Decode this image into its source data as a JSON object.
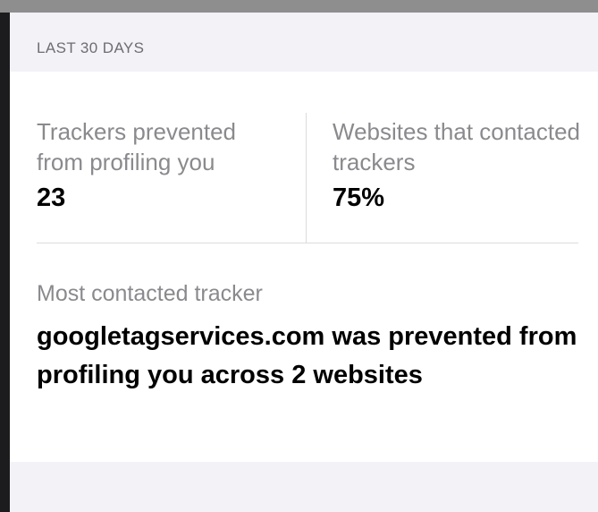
{
  "header": {
    "period_label": "LAST 30 DAYS"
  },
  "stats": {
    "trackers_prevented": {
      "label": "Trackers prevented from profiling you",
      "value": "23"
    },
    "websites_contacted": {
      "label": "Websites that contacted trackers",
      "value": "75%"
    }
  },
  "most_contacted": {
    "label": "Most contacted tracker",
    "description": "googletagservices.com was prevented from profiling you across 2 websites"
  },
  "colors": {
    "background": "#f2f2f7",
    "card": "#ffffff",
    "secondary_text": "#8a8a8e",
    "header_text": "#6d6d72",
    "divider": "#dcdcdf",
    "primary_text": "#000000"
  }
}
